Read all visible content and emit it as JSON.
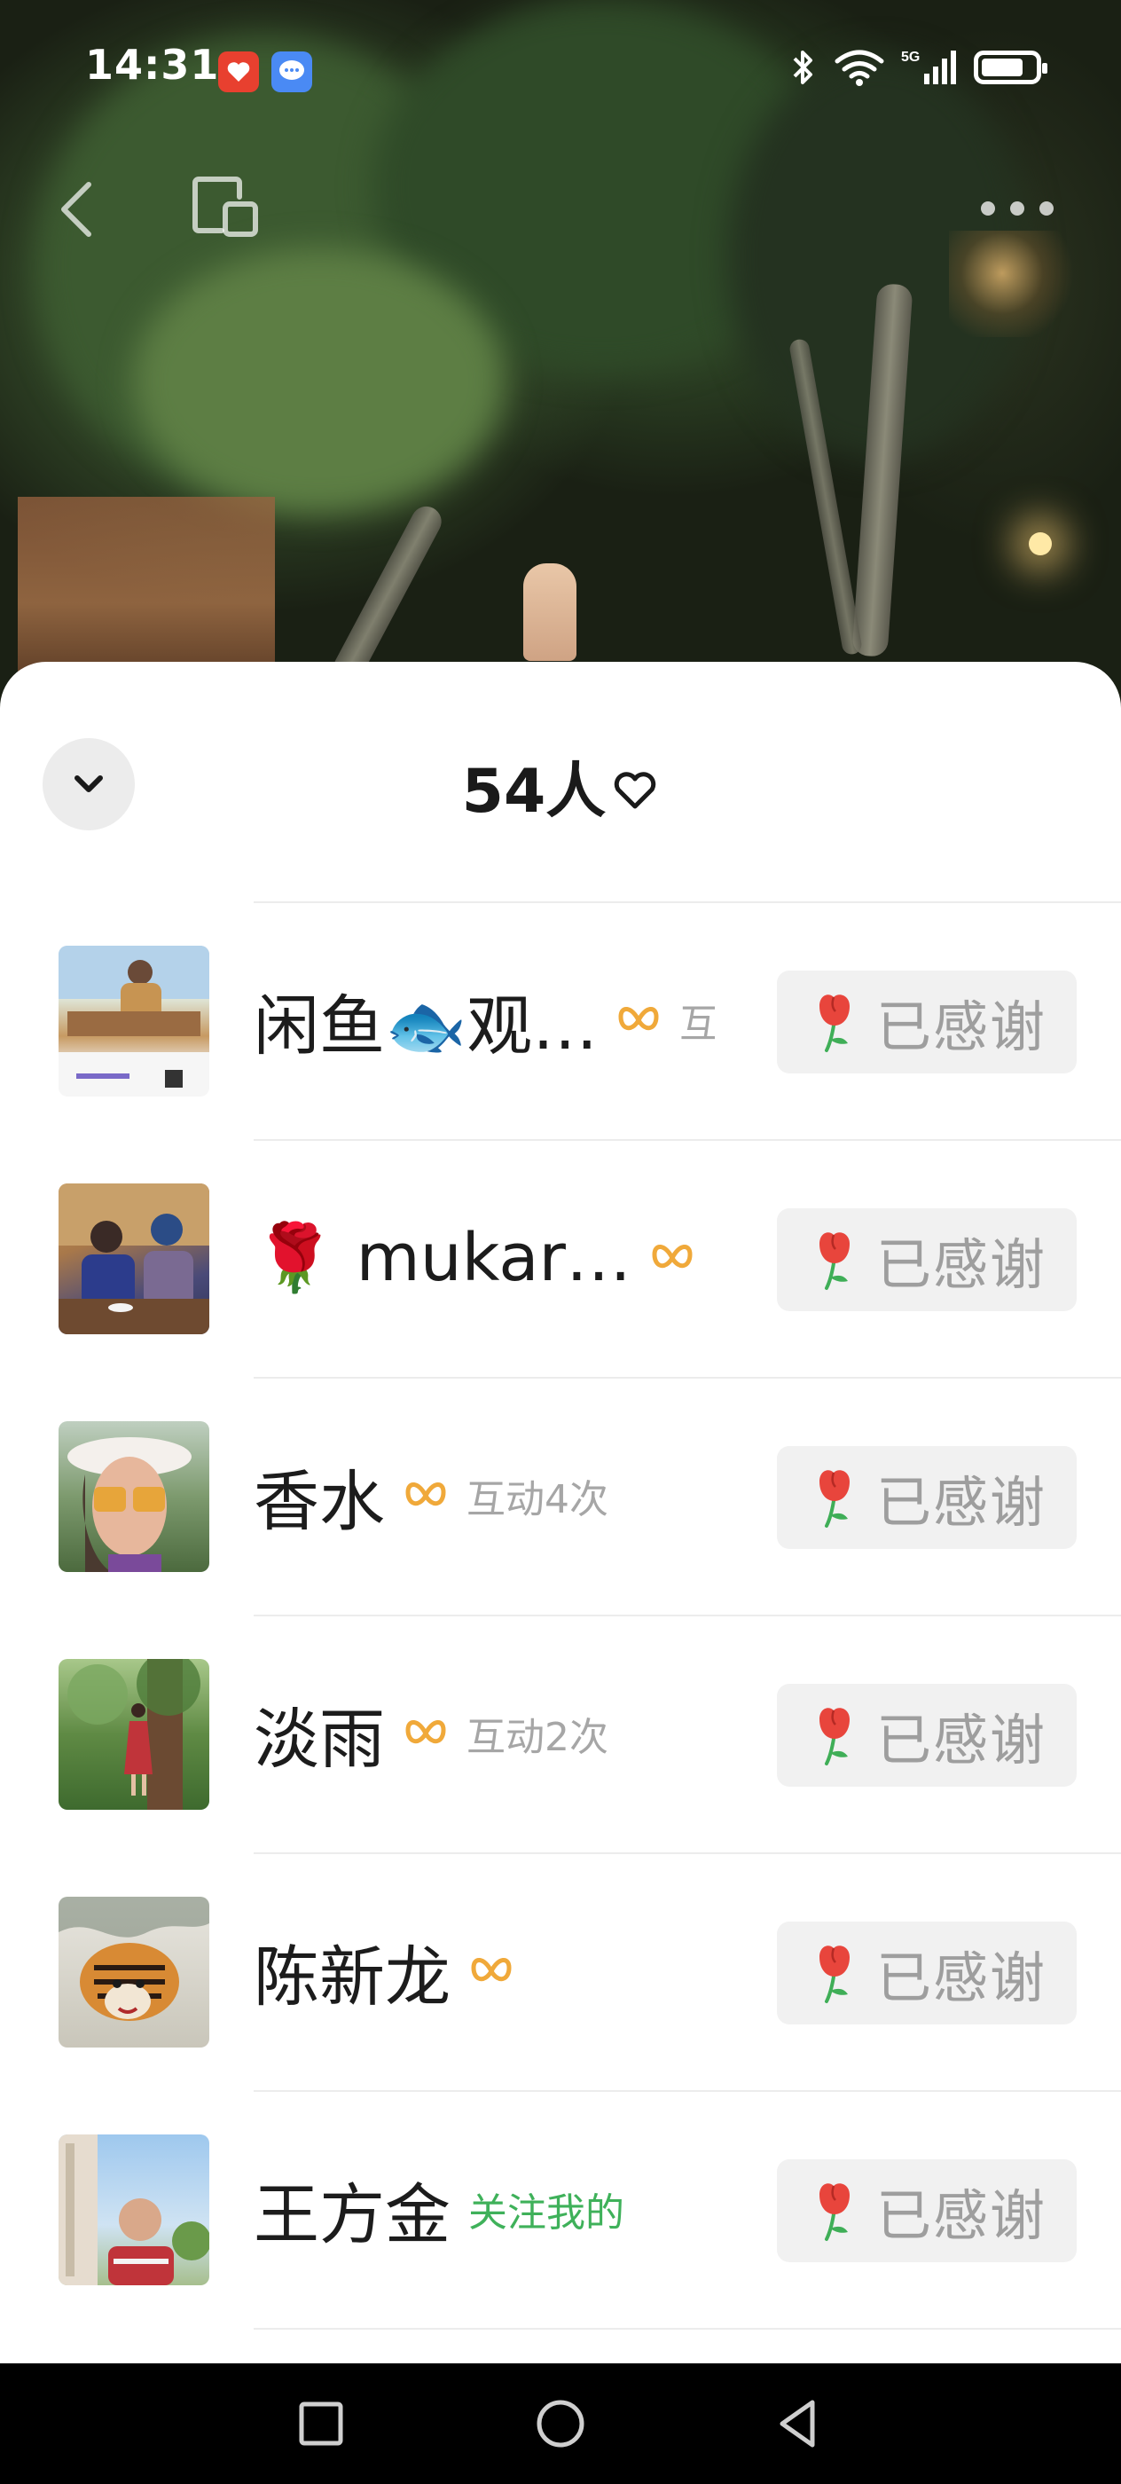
{
  "status_bar": {
    "time": "14:31",
    "notifications": [
      "app-notification-icon",
      "message-notification-icon"
    ],
    "icons": [
      "bluetooth-icon",
      "wifi-icon",
      "5g-signal-icon",
      "battery-icon"
    ],
    "battery_level": 0.8
  },
  "top_nav": {
    "back_icon": "chevron-left-icon",
    "window_icon": "floating-window-icon",
    "more_icon": "more-dots-icon"
  },
  "sheet": {
    "title": "54人",
    "title_icon": "heart-outline-icon",
    "collapse_icon": "chevron-down-icon"
  },
  "list": [
    {
      "name": "闲鱼🐟观…",
      "badge": "friend-badge-icon",
      "sub": "互",
      "sub_style": "gray",
      "button": "已感谢"
    },
    {
      "name": "🌹 mukar…",
      "badge": "friend-badge-icon",
      "sub": "",
      "sub_style": "gray",
      "button": "已感谢"
    },
    {
      "name": "香水",
      "badge": "friend-badge-icon",
      "sub": "互动4次",
      "sub_style": "gray",
      "button": "已感谢"
    },
    {
      "name": "淡雨",
      "badge": "friend-badge-icon",
      "sub": "互动2次",
      "sub_style": "gray",
      "button": "已感谢"
    },
    {
      "name": "陈新龙",
      "badge": "friend-badge-icon",
      "sub": "",
      "sub_style": "gray",
      "button": "已感谢"
    },
    {
      "name": "王方金",
      "badge": "",
      "sub": "关注我的",
      "sub_style": "green",
      "button": "已感谢"
    }
  ],
  "colors": {
    "accent_badge": "#f0a93a",
    "follow_green": "#3fb15a",
    "button_bg": "#f1f1f1",
    "button_text": "#9e9e9e",
    "rose_red": "#e8453c"
  },
  "system_nav": {
    "recent_icon": "square-recent-icon",
    "home_icon": "circle-home-icon",
    "back_icon": "triangle-back-icon"
  }
}
